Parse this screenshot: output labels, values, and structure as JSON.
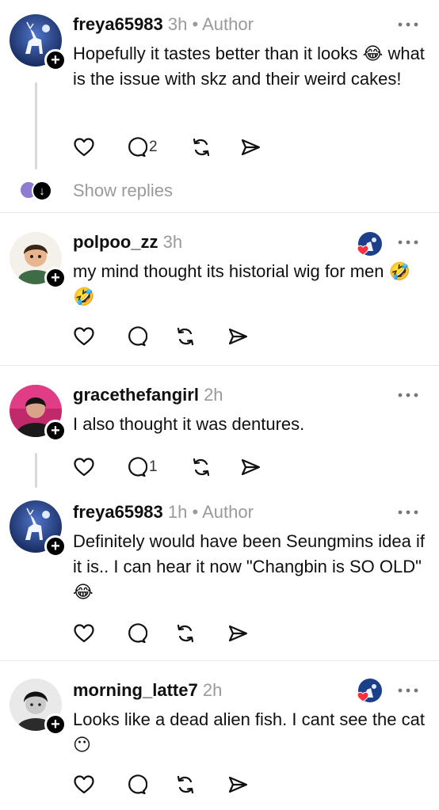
{
  "posts": [
    {
      "username": "freya65983",
      "time": "3h",
      "separator": "•",
      "role": "Author",
      "text": "Hopefully it tastes better than it looks 😂 what is the issue with skz and their weird cakes!",
      "reply_count": "2"
    },
    {
      "username": "polpoo_zz",
      "time": "3h",
      "text": "my mind thought its historial wig for men 🤣🤣",
      "reply_count": ""
    },
    {
      "username": "gracethefangirl",
      "time": "2h",
      "text": "I also thought it was dentures.",
      "reply_count": "1"
    },
    {
      "username": "freya65983",
      "time": "1h",
      "separator": "•",
      "role": "Author",
      "text": "Definitely would have been Seungmins idea if it is.. I can hear it now \"Changbin is SO OLD\" 😂",
      "reply_count": ""
    },
    {
      "username": "morning_latte7",
      "time": "2h",
      "text": "Looks like a dead alien fish. I cant see the cat😶",
      "reply_count": ""
    }
  ],
  "show_replies": "Show replies",
  "colors": {
    "text": "#101010",
    "muted": "#9a9a9a",
    "divider": "#e6e6e6",
    "like_badge": "#ff3040"
  }
}
